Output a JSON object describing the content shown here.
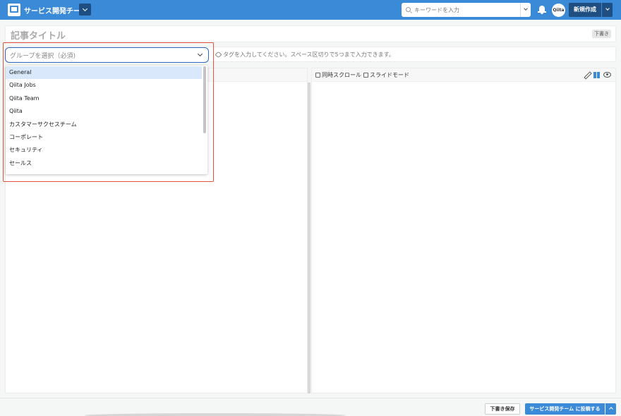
{
  "header": {
    "team_name": "サービス開発チーム",
    "search_placeholder": "キーワードを入力",
    "avatar_text": "Qiita",
    "new_button": "新規作成"
  },
  "title_field": {
    "placeholder": "記事タイトル",
    "badge": "下書き"
  },
  "tag_field": {
    "placeholder": "タグを入力してください。スペース区切りで5つまで入力できます。"
  },
  "group_select": {
    "placeholder": "グループを選択（必須)",
    "options": [
      "General",
      "Qiita Jobs",
      "Qiita Team",
      "Qiita",
      "カスタマーサクセスチーム",
      "コーポレート",
      "セキュリティ",
      "セールス"
    ],
    "highlighted": "General"
  },
  "preview_bar": {
    "sync_scroll": "同時スクロール",
    "slide_mode": "スライドモード"
  },
  "footer": {
    "save_draft": "下書き保存",
    "post_button": "サービス開発チーム に投稿する"
  },
  "colors": {
    "brand": "#3b8ad8",
    "dark": "#1f4f82",
    "highlight": "#e3533d"
  }
}
